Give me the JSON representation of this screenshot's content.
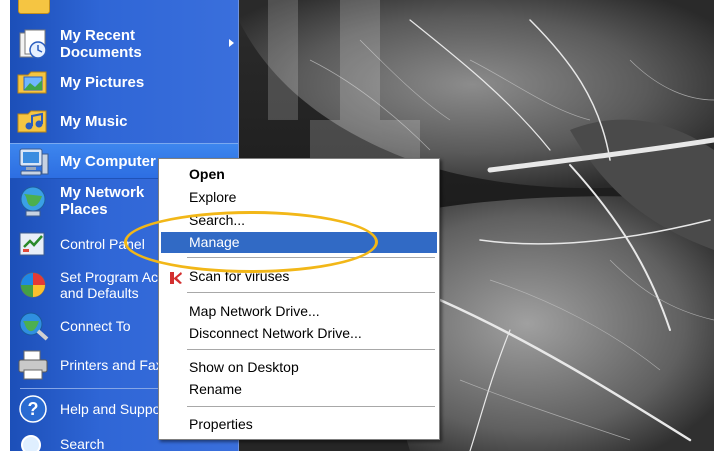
{
  "start_menu": {
    "items": [
      {
        "label_1": "My Recent",
        "label_2": "Documents",
        "icon": "recent-documents-icon"
      },
      {
        "label_1": "My Pictures",
        "icon": "my-pictures-icon"
      },
      {
        "label_1": "My Music",
        "icon": "my-music-icon"
      },
      {
        "label_1": "My Computer",
        "icon": "my-computer-icon"
      },
      {
        "label_1": "My Network",
        "label_2": "Places",
        "icon": "network-places-icon"
      },
      {
        "label_1": "Control Panel",
        "icon": "control-panel-icon"
      },
      {
        "label_1": "Set Program Access",
        "label_2": "and Defaults",
        "icon": "set-program-access-icon"
      },
      {
        "label_1": "Connect To",
        "icon": "connect-to-icon"
      },
      {
        "label_1": "Printers and Faxes",
        "icon": "printers-icon"
      },
      {
        "label_1": "Help and Support",
        "icon": "help-icon"
      },
      {
        "label_1": "Search",
        "icon": "search-icon"
      }
    ]
  },
  "context_menu": {
    "items": [
      {
        "label": "Open"
      },
      {
        "label": "Explore"
      },
      {
        "label": "Search..."
      },
      {
        "label": "Manage"
      },
      {
        "label": "Scan for viruses",
        "icon": "antivirus-icon"
      },
      {
        "label": "Map Network Drive..."
      },
      {
        "label": "Disconnect Network Drive..."
      },
      {
        "label": "Show on Desktop"
      },
      {
        "label": "Rename"
      },
      {
        "label": "Properties"
      }
    ]
  },
  "colors": {
    "start_menu_blue": "#2f66d6",
    "selection_blue": "#316ac5",
    "highlight_ellipse": "#f2b718"
  }
}
